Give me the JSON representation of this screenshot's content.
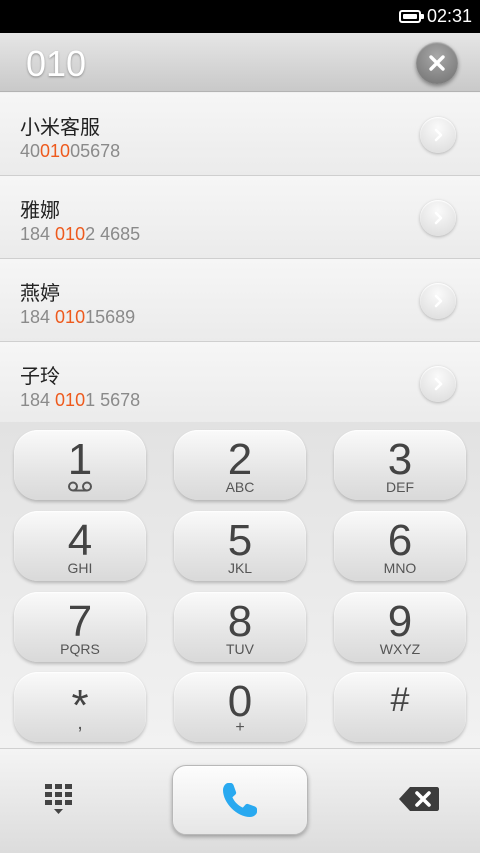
{
  "status_bar": {
    "time": "02:31"
  },
  "dialer": {
    "number": "010"
  },
  "contacts": [
    {
      "name": "小米客服",
      "number_pre": "40",
      "number_match": "010",
      "number_post": "05678"
    },
    {
      "name": "雅娜",
      "number_pre": "184 ",
      "number_match": "010",
      "number_post": "2 4685"
    },
    {
      "name": "燕婷",
      "number_pre": "184 ",
      "number_match": "010",
      "number_post": "15689"
    },
    {
      "name": "子玲",
      "number_pre": "184 ",
      "number_match": "010",
      "number_post": "1 5678"
    }
  ],
  "keypad": {
    "keys": [
      {
        "digit": "1",
        "letters": ""
      },
      {
        "digit": "2",
        "letters": "ABC"
      },
      {
        "digit": "3",
        "letters": "DEF"
      },
      {
        "digit": "4",
        "letters": "GHI"
      },
      {
        "digit": "5",
        "letters": "JKL"
      },
      {
        "digit": "6",
        "letters": "MNO"
      },
      {
        "digit": "7",
        "letters": "PQRS"
      },
      {
        "digit": "8",
        "letters": "TUV"
      },
      {
        "digit": "9",
        "letters": "WXYZ"
      },
      {
        "digit": "*",
        "letters": ","
      },
      {
        "digit": "0",
        "letters": "+"
      },
      {
        "digit": "#",
        "letters": ""
      }
    ]
  },
  "colors": {
    "highlight": "#ee5a1d",
    "call_icon": "#29a9f0"
  },
  "icons": {
    "battery": "battery-icon",
    "clear": "close-icon",
    "contact_action": "chevron-right-icon",
    "voicemail": "voicemail-icon",
    "dialpad": "dialpad-grid-icon",
    "call": "phone-icon",
    "backspace": "backspace-icon"
  }
}
